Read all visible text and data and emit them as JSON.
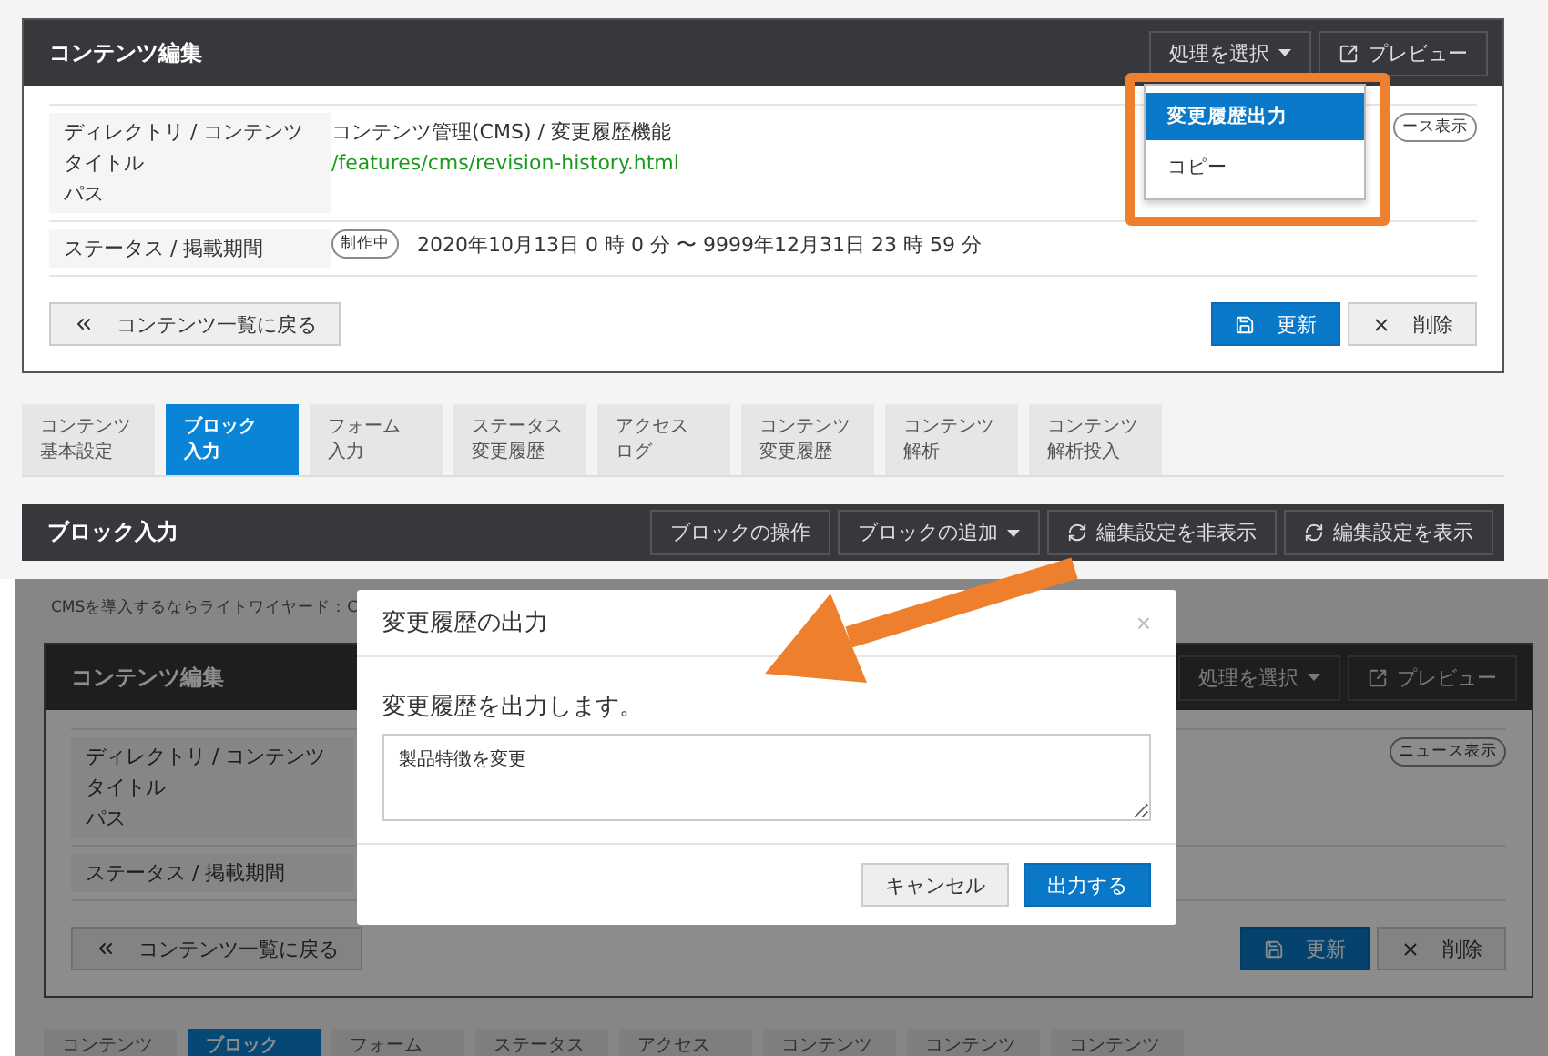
{
  "top": {
    "editor": {
      "title": "コンテンツ編集",
      "actions": [
        {
          "label": "処理を選択",
          "kind": "menu"
        },
        {
          "label": "プレビュー",
          "kind": "preview"
        }
      ],
      "title_label": "ディレクトリ / コンテンツタイトル",
      "path_label": "パス",
      "title_value": "コンテンツ管理(CMS) / 変更履歴機能",
      "path_value": "/features/cms/revision-history.html",
      "tag": "ース表示",
      "status_label": "ステータス / 掲載期間",
      "status_badge": "制作中",
      "period": "2020年10月13日 0 時  0 分 〜 9999年12月31日 23 時  59 分",
      "back_button": "コンテンツ一覧に戻る",
      "save_button": "更新",
      "delete_button": "削除"
    },
    "dropdown": [
      {
        "label": "変更履歴出力",
        "selected": true
      },
      {
        "label": "コピー",
        "selected": false
      }
    ],
    "tabs": [
      {
        "lines": [
          "コンテンツ",
          "基本設定"
        ],
        "selected": false
      },
      {
        "lines": [
          "ブロック",
          "入力"
        ],
        "selected": true
      },
      {
        "lines": [
          "フォーム",
          "入力"
        ],
        "selected": false
      },
      {
        "lines": [
          "ステータス",
          "変更履歴"
        ],
        "selected": false
      },
      {
        "lines": [
          "アクセス",
          "ログ"
        ],
        "selected": false
      },
      {
        "lines": [
          "コンテンツ",
          "変更履歴"
        ],
        "selected": false
      },
      {
        "lines": [
          "コンテンツ",
          "解析"
        ],
        "selected": false
      },
      {
        "lines": [
          "コンテンツ",
          "解析投入"
        ],
        "selected": false
      }
    ],
    "block_bar": {
      "title": "ブロック入力",
      "buttons": [
        {
          "label": "ブロックの操作",
          "kind": "plain"
        },
        {
          "label": "ブロックの追加",
          "kind": "menu"
        },
        {
          "label": "編集設定を非表示",
          "kind": "refresh"
        },
        {
          "label": "編集設定を表示",
          "kind": "refresh"
        }
      ]
    }
  },
  "bottom": {
    "intro": "CMSを導入するならライトワイヤード：C",
    "editor": {
      "title": "コンテンツ編集",
      "actions": [
        {
          "label": "処理を選択",
          "kind": "menu"
        },
        {
          "label": "プレビュー",
          "kind": "preview"
        }
      ],
      "title_label": "ディレクトリ / コンテンツタイトル",
      "path_label": "パス",
      "tag": "ニュース表示",
      "status_label": "ステータス / 掲載期間",
      "back_button": "コンテンツ一覧に戻る",
      "save_button": "更新",
      "delete_button": "削除"
    },
    "tabs": [
      {
        "lines": [
          "コンテンツ"
        ],
        "selected": false
      },
      {
        "lines": [
          "ブロック"
        ],
        "selected": true
      },
      {
        "lines": [
          "フォーム"
        ],
        "selected": false
      },
      {
        "lines": [
          "ステータス"
        ],
        "selected": false
      },
      {
        "lines": [
          "アクセス"
        ],
        "selected": false
      },
      {
        "lines": [
          "コンテンツ"
        ],
        "selected": false
      },
      {
        "lines": [
          "コンテンツ"
        ],
        "selected": false
      },
      {
        "lines": [
          "コンテンツ"
        ],
        "selected": false
      }
    ],
    "modal": {
      "title": "変更履歴の出力",
      "close": "×",
      "message": "変更履歴を出力します。",
      "value": "製品特徴を変更",
      "buttons": [
        {
          "label": "キャンセル",
          "kind": "secondary"
        },
        {
          "label": "出力する",
          "kind": "primary"
        }
      ]
    }
  }
}
